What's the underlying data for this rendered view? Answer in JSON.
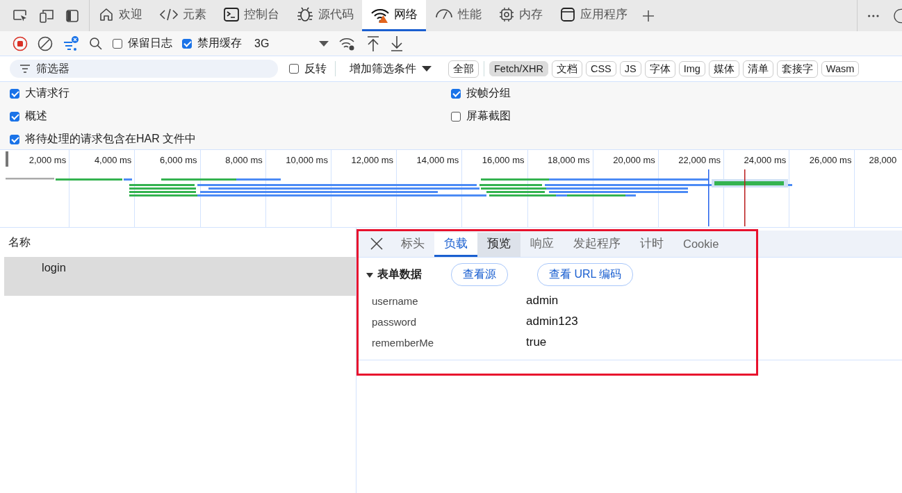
{
  "main_tabs": [
    {
      "label": "欢迎",
      "kind": "home",
      "selected": false,
      "warning": false
    },
    {
      "label": "元素",
      "kind": "code",
      "selected": false,
      "warning": false
    },
    {
      "label": "控制台",
      "kind": "console",
      "selected": false,
      "warning": false
    },
    {
      "label": "源代码",
      "kind": "bug",
      "selected": false,
      "warning": false
    },
    {
      "label": "网络",
      "kind": "wifi",
      "selected": true,
      "warning": true
    },
    {
      "label": "性能",
      "kind": "gauge",
      "selected": false,
      "warning": false
    },
    {
      "label": "内存",
      "kind": "chip",
      "selected": false,
      "warning": false
    },
    {
      "label": "应用程序",
      "kind": "window",
      "selected": false,
      "warning": false
    }
  ],
  "network_toolbar": {
    "recording": true,
    "preserve_log": {
      "label": "保留日志",
      "checked": false
    },
    "disable_cache": {
      "label": "禁用缓存",
      "checked": true
    },
    "throttling": "3G"
  },
  "filter_bar": {
    "placeholder": "筛选器",
    "invert": {
      "label": "反转",
      "checked": false
    },
    "more_filters": "增加筛选条件",
    "types": [
      {
        "label": "全部",
        "selected": false
      },
      {
        "label": "Fetch/XHR",
        "selected": true
      },
      {
        "label": "文档",
        "selected": false
      },
      {
        "label": "CSS",
        "selected": false
      },
      {
        "label": "JS",
        "selected": false
      },
      {
        "label": "字体",
        "selected": false
      },
      {
        "label": "Img",
        "selected": false
      },
      {
        "label": "媒体",
        "selected": false
      },
      {
        "label": "清单",
        "selected": false
      },
      {
        "label": "套接字",
        "selected": false
      },
      {
        "label": "Wasm",
        "selected": false
      }
    ]
  },
  "settings_left": [
    {
      "label": "大请求行",
      "checked": true
    },
    {
      "label": "概述",
      "checked": true
    },
    {
      "label": "将待处理的请求包含在HAR 文件中",
      "checked": true
    }
  ],
  "settings_right": [
    {
      "label": "按帧分组",
      "checked": true
    },
    {
      "label": "屏幕截图",
      "checked": false
    }
  ],
  "timeline_ticks": [
    "2,000 ms",
    "4,000 ms",
    "6,000 ms",
    "8,000 ms",
    "10,000 ms",
    "12,000 ms",
    "14,000 ms",
    "16,000 ms",
    "18,000 ms",
    "20,000 ms",
    "22,000 ms",
    "24,000 ms",
    "26,000 ms",
    "28,000"
  ],
  "request_list": {
    "column": "名称",
    "rows": [
      {
        "name": "login",
        "selected": true
      }
    ]
  },
  "detail": {
    "tabs": [
      {
        "label": "标头",
        "selected": false,
        "hovered": false
      },
      {
        "label": "负载",
        "selected": true,
        "hovered": false
      },
      {
        "label": "预览",
        "selected": false,
        "hovered": true
      },
      {
        "label": "响应",
        "selected": false,
        "hovered": false
      },
      {
        "label": "发起程序",
        "selected": false,
        "hovered": false
      },
      {
        "label": "计时",
        "selected": false,
        "hovered": false
      },
      {
        "label": "Cookie",
        "selected": false,
        "hovered": false
      }
    ],
    "section": {
      "title": "表单数据",
      "expanded": true,
      "buttons": [
        "查看源",
        "查看 URL 编码"
      ],
      "fields": [
        {
          "key": "username",
          "value": "admin"
        },
        {
          "key": "password",
          "value": "admin123"
        },
        {
          "key": "rememberMe",
          "value": "true"
        }
      ]
    }
  }
}
